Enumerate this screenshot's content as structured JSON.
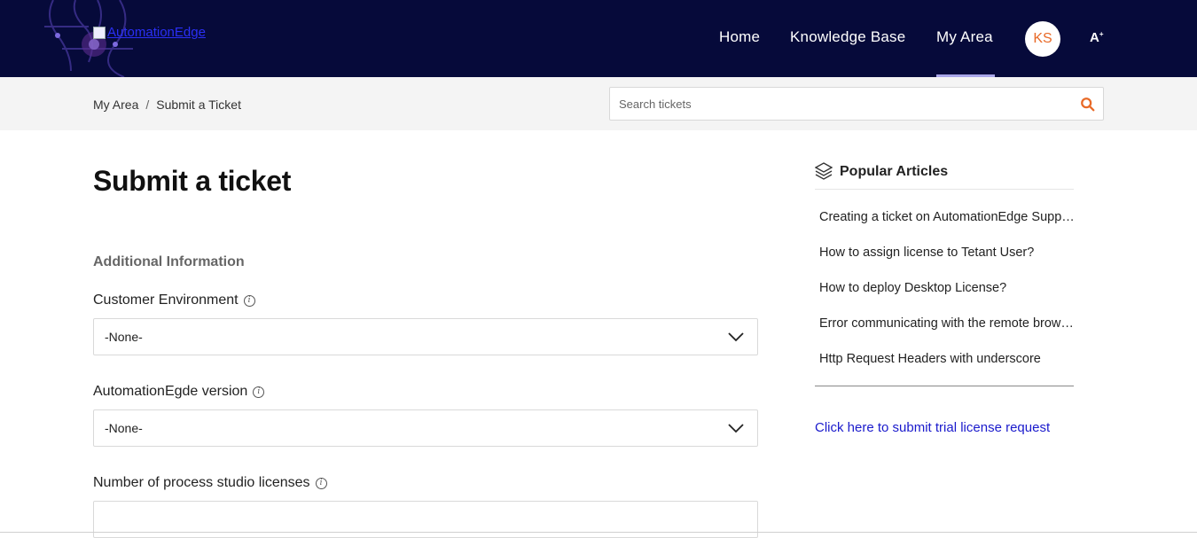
{
  "header": {
    "logo_alt": "AutomationEdge",
    "nav": [
      {
        "label": "Home"
      },
      {
        "label": "Knowledge Base"
      },
      {
        "label": "My Area"
      }
    ],
    "avatar_initials": "KS",
    "font_toggle": "A"
  },
  "breadcrumb": {
    "items": [
      "My Area",
      "Submit a Ticket"
    ],
    "separator": "/"
  },
  "search": {
    "placeholder": "Search tickets",
    "icon": "search-icon"
  },
  "main": {
    "title": "Submit a ticket",
    "section_title": "Additional Information",
    "fields": [
      {
        "label": "Customer Environment",
        "value": "-None-"
      },
      {
        "label": "AutomationEgde version",
        "value": "-None-"
      },
      {
        "label": "Number of process studio licenses",
        "value": ""
      }
    ]
  },
  "sidebar": {
    "title": "Popular Articles",
    "articles": [
      "Creating a ticket on AutomationEdge Support Portal",
      "How to assign license to Tetant User?",
      "How to deploy Desktop License?",
      "Error communicating with the remote browser",
      "Http Request Headers with underscore"
    ],
    "trial_link": "Click here to submit trial license request"
  },
  "colors": {
    "header_bg": "#060a3a",
    "accent_orange": "#e86a28",
    "link_blue": "#1a1acc"
  }
}
